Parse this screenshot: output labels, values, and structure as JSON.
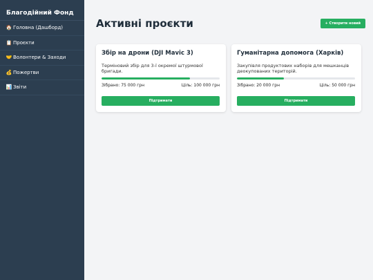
{
  "sidebar": {
    "brand": "Благодійний Фонд",
    "items": [
      {
        "icon": "🏠",
        "label": "Головна (Дашборд)"
      },
      {
        "icon": "📋",
        "label": "Проєкти"
      },
      {
        "icon": "🤝",
        "label": "Волонтери & Заходи"
      },
      {
        "icon": "💰",
        "label": "Пожертви"
      },
      {
        "icon": "📊",
        "label": "Звіти"
      }
    ]
  },
  "main": {
    "title": "Активні проєкти",
    "create_button": "+ Створити новий",
    "projects": [
      {
        "title": "Збір на дрони (DJI Mavic 3)",
        "description": "Терміновий збір для 3-ї окремої штурмової бригади.",
        "collected": "Зібрано: 75 000 грн",
        "goal": "Ціль: 100 000 грн",
        "progress": 0.75,
        "button": "Підтримати"
      },
      {
        "title": "Гуманітарна допомога (Харків)",
        "description": "Закупівля продуктових наборів для мешканців деокупованих територій.",
        "collected": "Зібрано: 20 000 грн",
        "goal": "Ціль: 50 000 грн",
        "progress": 0.4,
        "button": "Підтримати"
      }
    ]
  },
  "colors": {
    "sidebar": "#2c3e50",
    "accent": "#27ae60",
    "background": "#f3f4f6"
  }
}
